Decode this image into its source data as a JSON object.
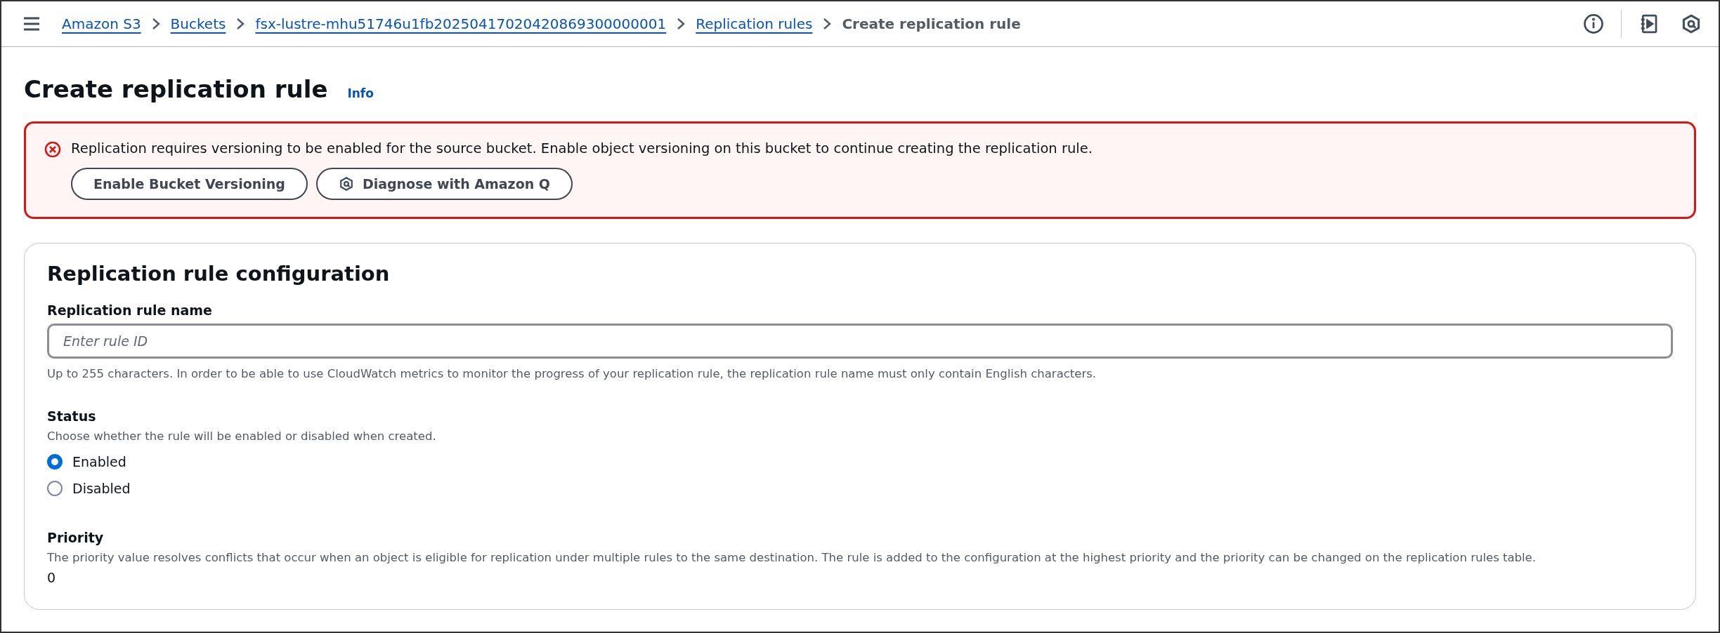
{
  "breadcrumbs": [
    {
      "label": "Amazon S3",
      "link": true
    },
    {
      "label": "Buckets",
      "link": true
    },
    {
      "label": "fsx-lustre-mhu51746u1fb20250417020420869300000001",
      "link": true
    },
    {
      "label": "Replication rules",
      "link": true
    },
    {
      "label": "Create replication rule",
      "link": false
    }
  ],
  "page": {
    "title": "Create replication rule",
    "info": "Info"
  },
  "alert": {
    "message": "Replication requires versioning to be enabled for the source bucket. Enable object versioning on this bucket to continue creating the replication rule.",
    "buttons": [
      {
        "label": "Enable Bucket Versioning",
        "kind": "plain"
      },
      {
        "label": "Diagnose with Amazon Q",
        "kind": "q"
      }
    ]
  },
  "panel": {
    "title": "Replication rule configuration",
    "name_field": {
      "label": "Replication rule name",
      "placeholder": "Enter rule ID",
      "hint": "Up to 255 characters. In order to be able to use CloudWatch metrics to monitor the progress of your replication rule, the replication rule name must only contain English characters."
    },
    "status": {
      "label": "Status",
      "description": "Choose whether the rule will be enabled or disabled when created.",
      "options": [
        {
          "label": "Enabled",
          "selected": true
        },
        {
          "label": "Disabled",
          "selected": false
        }
      ]
    },
    "priority": {
      "label": "Priority",
      "description": "The priority value resolves conflicts that occur when an object is eligible for replication under multiple rules to the same destination. The rule is added to the configuration at the highest priority and the priority can be changed on the replication rules table.",
      "value": "0"
    }
  }
}
